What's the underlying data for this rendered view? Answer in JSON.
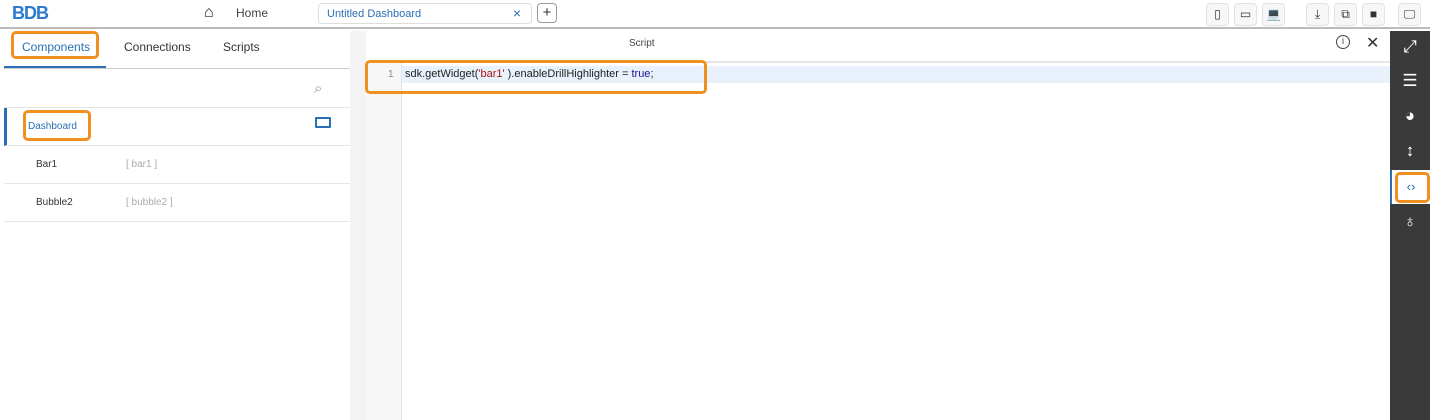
{
  "header": {
    "logo": "BDB",
    "home": "Home",
    "tab_title": "Untitled Dashboard",
    "close": "×",
    "add": "+"
  },
  "toolbar": [
    {
      "icon": "mobile-icon",
      "glyph": "▯"
    },
    {
      "icon": "tablet-icon",
      "glyph": "▭"
    },
    {
      "icon": "laptop-icon",
      "glyph": "💻"
    },
    {
      "icon": "download-icon",
      "glyph": "⤓"
    },
    {
      "icon": "copy-icon",
      "glyph": "⧉"
    },
    {
      "icon": "save-icon",
      "glyph": "■"
    },
    {
      "icon": "preview-icon",
      "glyph": "🖵"
    }
  ],
  "left": {
    "tabs": [
      "Components",
      "Connections",
      "Scripts"
    ],
    "dashboard": "Dashboard",
    "items": [
      {
        "name": "Bar1",
        "id": "[ bar1 ]"
      },
      {
        "name": "Bubble2",
        "id": "[ bubble2 ]"
      }
    ]
  },
  "script": {
    "title": "Script",
    "line_no": "1",
    "code_a": "sdk.getWidget(",
    "code_str": "'bar1'",
    "code_b": " ).enableDrillHighlighter = ",
    "code_kw": "true",
    "code_end": ";"
  },
  "accent": "#f0901e"
}
